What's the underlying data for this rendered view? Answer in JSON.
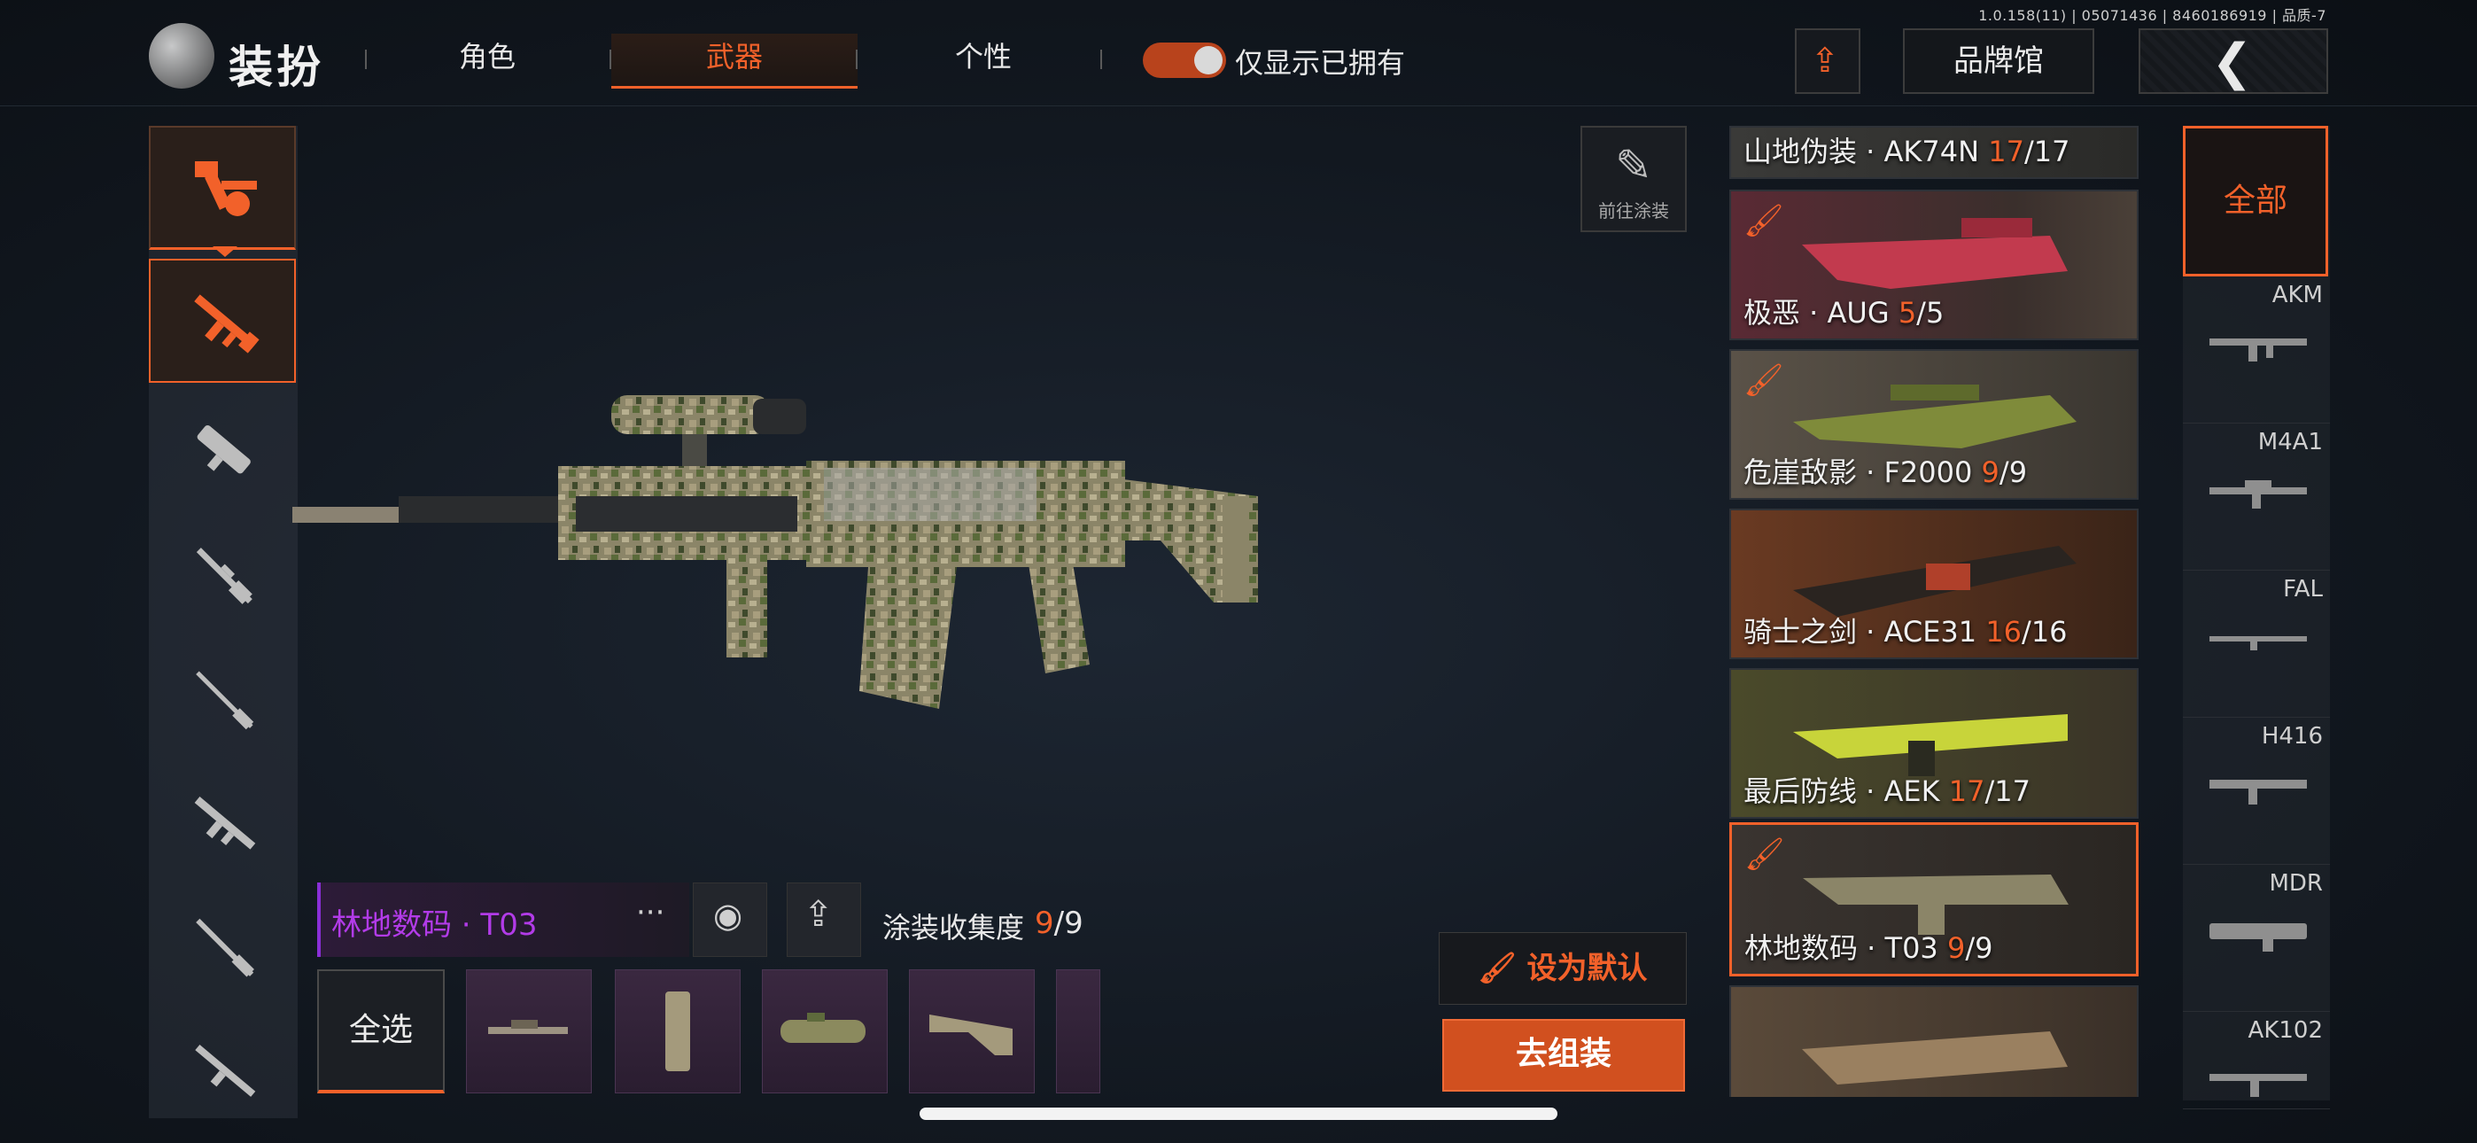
{
  "version": "1.0.158(11) | 05071436 | 8460186919 | 品质-7",
  "header": {
    "title": "装扮",
    "tabs": [
      {
        "label": "角色",
        "active": false
      },
      {
        "label": "武器",
        "active": true
      },
      {
        "label": "个性",
        "active": false
      }
    ],
    "owned_toggle_label": "仅显示已拥有",
    "owned_toggle_on": true,
    "brand_button": "品牌馆"
  },
  "go_paint_label": "前往涂装",
  "current_skin": {
    "name": "林地数码 · T03",
    "more": "···",
    "collection_label": "涂装收集度",
    "collected": "9",
    "total": "/9"
  },
  "parts": {
    "select_all": "全选",
    "items": [
      "scope-icon",
      "grip-icon",
      "sight-icon",
      "stock-icon",
      "part-icon"
    ]
  },
  "actions": {
    "set_default": "设为默认",
    "assemble": "去组装"
  },
  "skin_list": [
    {
      "label": "山地伪装 · AK74N ",
      "owned": "17",
      "total": "/17",
      "new": false,
      "selected": false
    },
    {
      "label": "极恶 · AUG ",
      "owned": "5",
      "total": "/5",
      "new": true,
      "selected": false
    },
    {
      "label": "危崖敌影 · F2000 ",
      "owned": "9",
      "total": "/9",
      "new": true,
      "selected": false
    },
    {
      "label": "骑士之剑 · ACE31 ",
      "owned": "16",
      "total": "/16",
      "new": false,
      "selected": false
    },
    {
      "label": "最后防线 · AEK ",
      "owned": "17",
      "total": "/17",
      "new": false,
      "selected": false
    },
    {
      "label": "林地数码 · T03 ",
      "owned": "9",
      "total": "/9",
      "new": true,
      "selected": true
    },
    {
      "label": "",
      "owned": "",
      "total": "",
      "new": false,
      "selected": false
    }
  ],
  "weapon_categories": {
    "all": "全部",
    "items": [
      "AKM",
      "M4A1",
      "FAL",
      "H416",
      "MDR",
      "AK102"
    ]
  },
  "colors": {
    "accent": "#f2612a",
    "epic_purple": "#b23be8",
    "background": "#121820"
  }
}
